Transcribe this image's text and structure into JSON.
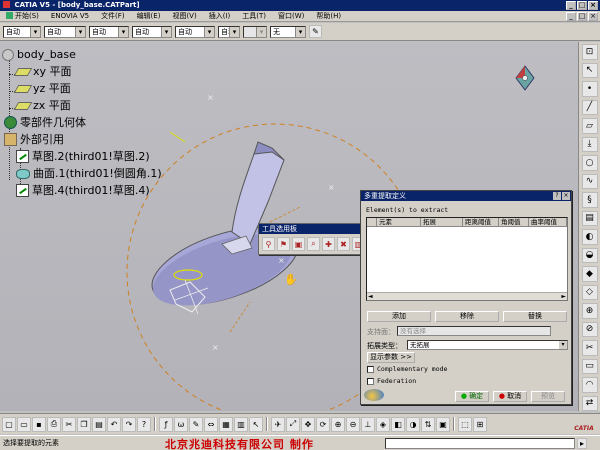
{
  "window": {
    "title": "CATIA V5 - [body_base.CATPart]",
    "controls": [
      "_",
      "□",
      "×"
    ]
  },
  "menu": {
    "items": [
      "开始(S)",
      "ENOVIA V5",
      "文件(F)",
      "编辑(E)",
      "视图(V)",
      "插入(I)",
      "工具(T)",
      "窗口(W)",
      "帮助(H)"
    ],
    "doc_controls": [
      "_",
      "□",
      "×"
    ]
  },
  "properties": {
    "combos": [
      "自动",
      "自动",
      "自动",
      "自动",
      "自动",
      "自动"
    ],
    "layer_short": "无"
  },
  "tree": {
    "root": "body_base",
    "planes": [
      "xy 平面",
      "yz 平面",
      "zx 平面"
    ],
    "part_body": "零部件几何体",
    "external": "外部引用",
    "external_children": [
      "草图.2(third01!草图.2)",
      "曲面.1(third01!倒圆角.1)",
      "草图.4(third01!草图.4)"
    ]
  },
  "tools_palette": {
    "title": "工具选用板",
    "close": "×"
  },
  "dialog": {
    "title": "多重提取定义",
    "controls": [
      "?",
      "×"
    ],
    "elements_label": "Element(s) to extract",
    "columns": [
      "元素",
      "拓展",
      "距离阈值",
      "角阈值",
      "曲率阈值"
    ],
    "hscroll_left": "◄",
    "hscroll_right": "►",
    "buttons": {
      "add": "添加",
      "remove": "移除",
      "replace": "替换"
    },
    "support_label": "支持面：",
    "support_value": "没有选择",
    "propagation_label": "拓展类型：",
    "propagation_value": "无拓展",
    "show_params": "显示参数 >>",
    "complementary": "Complementary mode",
    "federation": "Federation",
    "ok": "确定",
    "cancel": "取消",
    "preview": "预览"
  },
  "status": {
    "message": "选择要提取的元素",
    "watermark": "北京兆迪科技有限公司  制作",
    "logo": "CATIA"
  }
}
